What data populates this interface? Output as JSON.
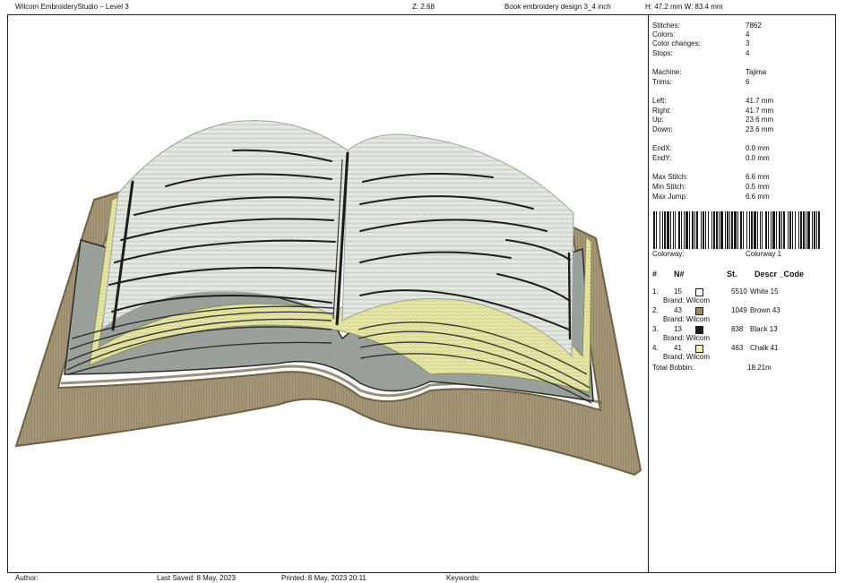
{
  "header": {
    "app_title": "Wilcom EmbroideryStudio – Level 3",
    "zoom": "Z: 2.68",
    "design_name": "Book embroidery design 3_4  inch",
    "dimensions": "H: 47.2 mm   W: 83.4 mm"
  },
  "stats": [
    {
      "label": "Stitches:",
      "value": "7862"
    },
    {
      "label": "Colors:",
      "value": "4"
    },
    {
      "label": "Color changes:",
      "value": "3"
    },
    {
      "label": "Stops:",
      "value": "4"
    },
    {
      "label": "Machine:",
      "value": "Tajima"
    },
    {
      "label": "Trims:",
      "value": "6"
    },
    {
      "label": "Left:",
      "value": "41.7 mm"
    },
    {
      "label": "Right:",
      "value": "41.7 mm"
    },
    {
      "label": "Up:",
      "value": "23.6 mm"
    },
    {
      "label": "Down:",
      "value": "23.6 mm"
    },
    {
      "label": "EndX:",
      "value": "0.0 mm"
    },
    {
      "label": "EndY:",
      "value": "0.0 mm"
    },
    {
      "label": "Max Stitch:",
      "value": "6.6 mm"
    },
    {
      "label": "Min Stitch:",
      "value": "0.5 mm"
    },
    {
      "label": "Max Jump:",
      "value": "6.6 mm"
    }
  ],
  "colorway": {
    "label": "Colorway:",
    "value": "Colorway 1"
  },
  "table": {
    "headers": {
      "num": "#",
      "n": "N#",
      "st": "St.",
      "descr": "Descr _Code"
    },
    "rows": [
      {
        "index": "1.",
        "code": "15",
        "color": "#ffffff",
        "stitches": "5510",
        "descr": "White 15",
        "brand": "Brand: Wilcom"
      },
      {
        "index": "2.",
        "code": "43",
        "color": "#9a8866",
        "stitches": "1049",
        "descr": "Brown 43",
        "brand": "Brand: Wilcom"
      },
      {
        "index": "3.",
        "code": "13",
        "color": "#1a1a1a",
        "stitches": "838",
        "descr": "Black 13",
        "brand": "Brand: Wilcom"
      },
      {
        "index": "4.",
        "code": "41",
        "color": "#f0eeb0",
        "stitches": "463",
        "descr": "Chalk 41",
        "brand": "Brand: Wilcom"
      }
    ]
  },
  "total_bobbin": {
    "label": "Total Bobbin:",
    "value": "18.21m"
  },
  "footer": {
    "author_label": "Author:",
    "last_saved": "Last Saved:  8 May, 2023",
    "printed": "Printed:  8 May, 2023 20:11",
    "keywords_label": "Keywords:"
  },
  "design_colors": {
    "cover": "#a8987a",
    "cover_dark": "#7a6a4c",
    "page": "#dfe4dc",
    "chalk": "#e6e6a6",
    "ink": "#1e1e1e"
  }
}
